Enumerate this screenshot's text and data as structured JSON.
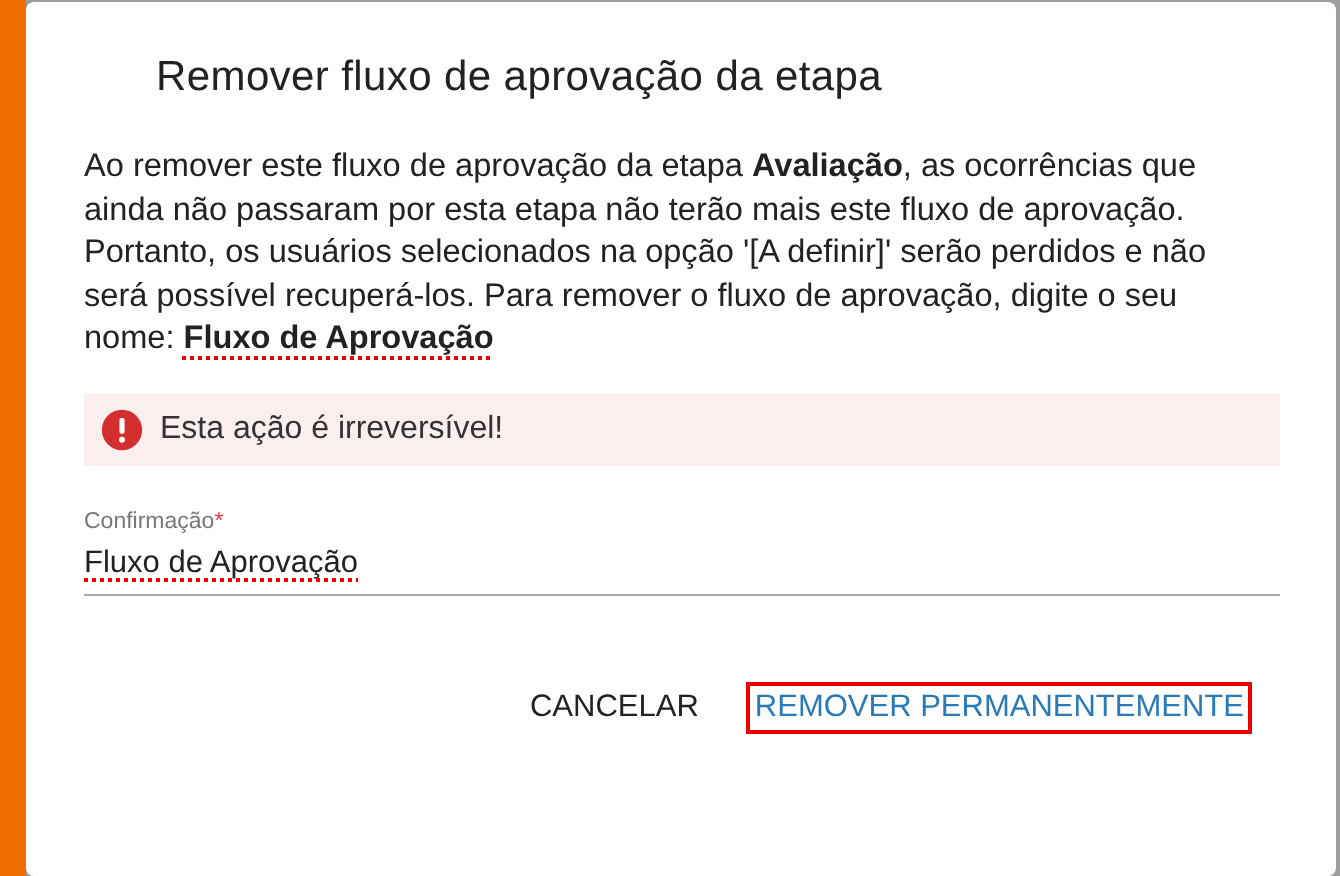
{
  "dialog": {
    "title": "Remover fluxo de aprovação da etapa",
    "message": [
      {
        "text": "Ao remover este fluxo de aprovação da etapa ",
        "bold": false,
        "misspelled": false
      },
      {
        "text": "Avaliação",
        "bold": true,
        "misspelled": false
      },
      {
        "text": ", as ocorrências que ainda não passaram por esta etapa não terão mais este fluxo de aprovação. Portanto, os usuários selecionados na opção '[A definir]' serão perdidos e não será possível recuperá-los. Para remover o fluxo de aprovação, digite o seu nome: ",
        "bold": false,
        "misspelled": false
      },
      {
        "text": "Fluxo de Aprovação",
        "bold": true,
        "misspelled": true
      }
    ],
    "alert": {
      "text": "Esta ação é irreversível!"
    },
    "field": {
      "label": "Confirmação",
      "required_mark": "*",
      "value": "Fluxo de Aprovação",
      "misspelled": true
    },
    "buttons": [
      {
        "label": "CANCELAR",
        "kind": "plain",
        "highlighted": false
      },
      {
        "label": "REMOVER PERMANENTEMENTE",
        "kind": "primary",
        "highlighted": true
      }
    ]
  }
}
